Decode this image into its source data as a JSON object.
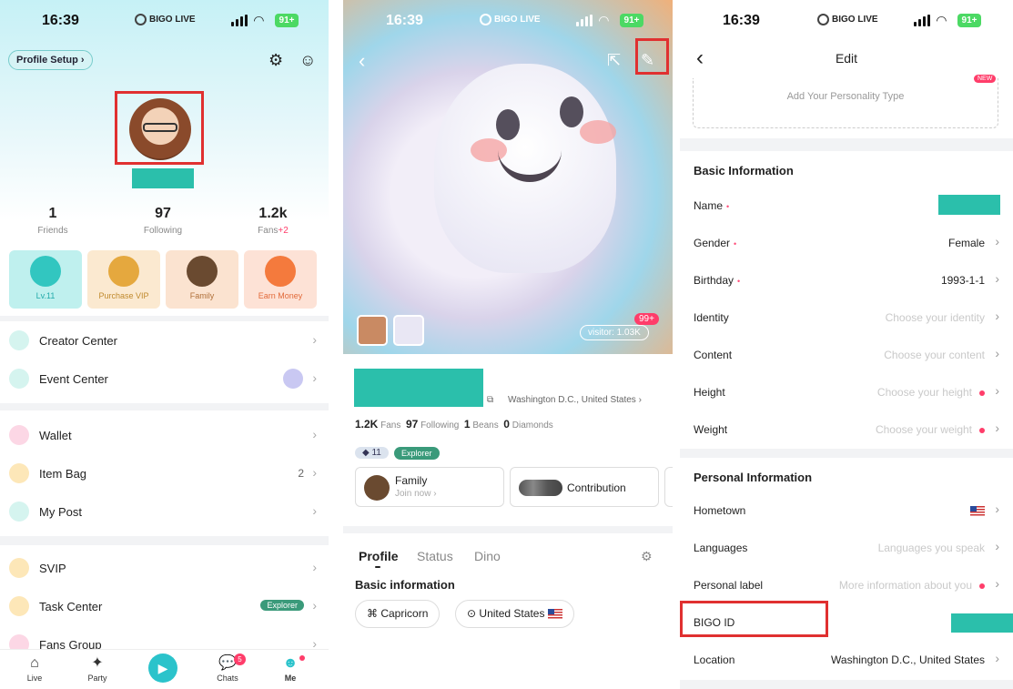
{
  "status_bar": {
    "time": "16:39",
    "brand": "BIGO LIVE",
    "battery": "91+"
  },
  "me_screen": {
    "profile_setup": "Profile Setup",
    "stats": [
      {
        "value": "1",
        "label": "Friends"
      },
      {
        "value": "97",
        "label": "Following"
      },
      {
        "value": "1.2k",
        "label": "Fans",
        "delta": "+2"
      }
    ],
    "tiles": [
      {
        "label": "Lv.11",
        "color": "#bff0ee",
        "icon_color": "#32c6c0"
      },
      {
        "label": "Purchase VIP",
        "color": "#fbe9d0",
        "icon_color": "#e5a83e"
      },
      {
        "label": "Family",
        "color": "#fbe3d0",
        "icon_color": "#6a4a30"
      },
      {
        "label": "Earn Money",
        "color": "#fde2d6",
        "icon_color": "#f47a3d"
      }
    ],
    "menu": [
      {
        "label": "Creator Center",
        "icon": "chart-icon",
        "color": "#3cc9b5",
        "extra": ""
      },
      {
        "label": "Event Center",
        "icon": "megaphone-icon",
        "color": "#3cc9b5",
        "extra": ""
      },
      {
        "label": "Wallet",
        "icon": "wallet-icon",
        "color": "#f56fa0",
        "extra": ""
      },
      {
        "label": "Item Bag",
        "icon": "bag-icon",
        "color": "#f7b93a",
        "extra": "2"
      },
      {
        "label": "My Post",
        "icon": "post-icon",
        "color": "#3cc9b5",
        "extra": ""
      },
      {
        "label": "SVIP",
        "icon": "svip-icon",
        "color": "#f7b93a",
        "extra": ""
      },
      {
        "label": "Task Center",
        "icon": "task-icon",
        "color": "#f7b93a",
        "extra": "Explorer"
      },
      {
        "label": "Fans Group",
        "icon": "fans-icon",
        "color": "#f56fa0",
        "extra": ""
      }
    ],
    "tabbar": [
      {
        "label": "Live"
      },
      {
        "label": "Party"
      },
      {
        "label": ""
      },
      {
        "label": "Chats",
        "badge": "5"
      },
      {
        "label": "Me"
      }
    ]
  },
  "profile_screen": {
    "visitor": "visitor: 1.03K",
    "badge": "99+",
    "location": "Washington D.C., United States",
    "counts": [
      {
        "value": "1.2K",
        "label": "Fans"
      },
      {
        "value": "97",
        "label": "Following"
      },
      {
        "value": "1",
        "label": "Beans"
      },
      {
        "value": "0",
        "label": "Diamonds"
      }
    ],
    "level": "11",
    "explorer": "Explorer",
    "family_title": "Family",
    "family_sub": "Join now",
    "contribution": "Contribution",
    "tabs": [
      "Profile",
      "Status",
      "Dino"
    ],
    "basic_info_title": "Basic information",
    "chips": [
      "Capricorn",
      "United States"
    ]
  },
  "edit_screen": {
    "title": "Edit",
    "personality": "Add Your Personality Type",
    "new_badge": "NEW",
    "basic_title": "Basic Information",
    "basic_rows": [
      {
        "label": "Name",
        "value": "",
        "required": true
      },
      {
        "label": "Gender",
        "value": "Female",
        "required": true
      },
      {
        "label": "Birthday",
        "value": "1993-1-1",
        "required": true
      },
      {
        "label": "Identity",
        "placeholder": "Choose your identity"
      },
      {
        "label": "Content",
        "placeholder": "Choose your content"
      },
      {
        "label": "Height",
        "placeholder": "Choose your height",
        "dot": true
      },
      {
        "label": "Weight",
        "placeholder": "Choose your weight",
        "dot": true
      }
    ],
    "personal_title": "Personal Information",
    "personal_rows": [
      {
        "label": "Hometown",
        "value": ""
      },
      {
        "label": "Languages",
        "placeholder": "Languages you speak"
      },
      {
        "label": "Personal label",
        "placeholder": "More information about you",
        "dot": true
      },
      {
        "label": "BIGO ID",
        "value": ""
      },
      {
        "label": "Location",
        "value": "Washington D.C., United States"
      }
    ]
  }
}
